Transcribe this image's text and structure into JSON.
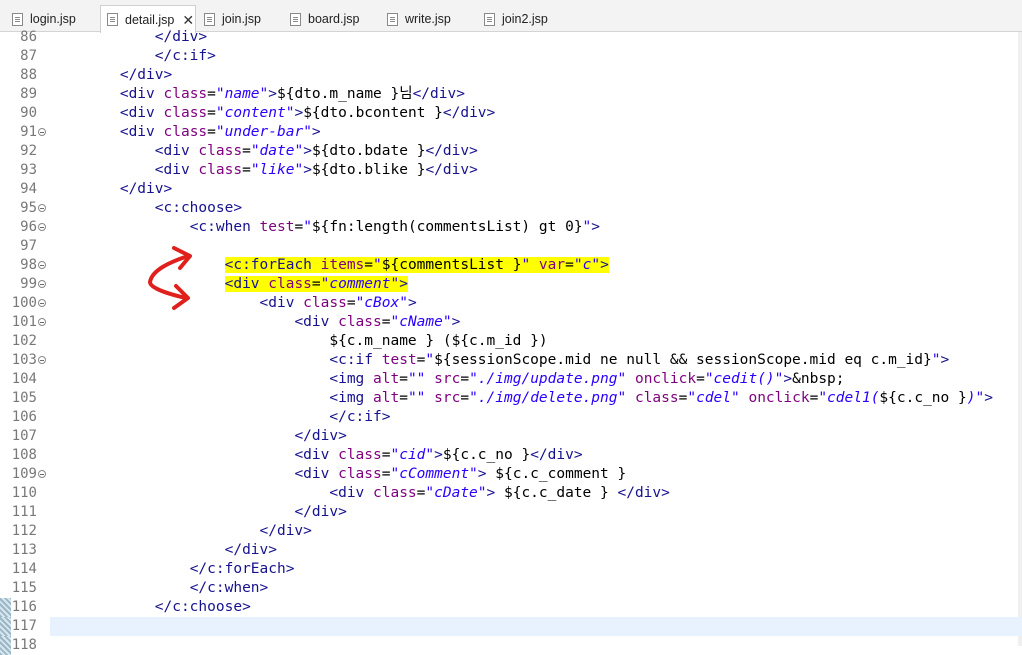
{
  "tabs": [
    {
      "label": "login.jsp",
      "active": false
    },
    {
      "label": "detail.jsp",
      "active": true,
      "close": "✕"
    },
    {
      "label": "join.jsp",
      "active": false
    },
    {
      "label": "board.jsp",
      "active": false
    },
    {
      "label": "write.jsp",
      "active": false
    },
    {
      "label": "join2.jsp",
      "active": false
    }
  ],
  "colors": {
    "tag": "#17128e",
    "attribute": "#7f007f",
    "value": "#2a00ff",
    "highlight": "#ffff00",
    "annotation": "#e0201c"
  },
  "lines": [
    {
      "n": "86",
      "fold": false,
      "segs": [
        [
          "t",
          "            "
        ],
        [
          "tag",
          "</div>"
        ]
      ]
    },
    {
      "n": "87",
      "fold": false,
      "segs": [
        [
          "t",
          "            "
        ],
        [
          "tag",
          "</c:if>"
        ]
      ]
    },
    {
      "n": "88",
      "fold": false,
      "segs": [
        [
          "t",
          "        "
        ],
        [
          "tag",
          "</div>"
        ]
      ]
    },
    {
      "n": "89",
      "fold": false,
      "segs": [
        [
          "t",
          "        "
        ],
        [
          "tag",
          "<div "
        ],
        [
          "attr",
          "class"
        ],
        [
          "t",
          "="
        ],
        [
          "val",
          "\"name\""
        ],
        [
          "tag",
          ">"
        ],
        [
          "t",
          "${dto.m_name }님"
        ],
        [
          "tag",
          "</div>"
        ]
      ]
    },
    {
      "n": "90",
      "fold": false,
      "segs": [
        [
          "t",
          "        "
        ],
        [
          "tag",
          "<div "
        ],
        [
          "attr",
          "class"
        ],
        [
          "t",
          "="
        ],
        [
          "val",
          "\"content\""
        ],
        [
          "tag",
          ">"
        ],
        [
          "t",
          "${dto.bcontent }"
        ],
        [
          "tag",
          "</div>"
        ]
      ]
    },
    {
      "n": "91",
      "fold": true,
      "segs": [
        [
          "t",
          "        "
        ],
        [
          "tag",
          "<div "
        ],
        [
          "attr",
          "class"
        ],
        [
          "t",
          "="
        ],
        [
          "val",
          "\"under-bar\""
        ],
        [
          "tag",
          ">"
        ]
      ]
    },
    {
      "n": "92",
      "fold": false,
      "segs": [
        [
          "t",
          "            "
        ],
        [
          "tag",
          "<div "
        ],
        [
          "attr",
          "class"
        ],
        [
          "t",
          "="
        ],
        [
          "val",
          "\"date\""
        ],
        [
          "tag",
          ">"
        ],
        [
          "t",
          "${dto.bdate }"
        ],
        [
          "tag",
          "</div>"
        ]
      ]
    },
    {
      "n": "93",
      "fold": false,
      "segs": [
        [
          "t",
          "            "
        ],
        [
          "tag",
          "<div "
        ],
        [
          "attr",
          "class"
        ],
        [
          "t",
          "="
        ],
        [
          "val",
          "\"like\""
        ],
        [
          "tag",
          ">"
        ],
        [
          "t",
          "${dto.blike }"
        ],
        [
          "tag",
          "</div>"
        ]
      ]
    },
    {
      "n": "94",
      "fold": false,
      "segs": [
        [
          "t",
          "        "
        ],
        [
          "tag",
          "</div>"
        ]
      ]
    },
    {
      "n": "95",
      "fold": true,
      "segs": [
        [
          "t",
          "            "
        ],
        [
          "tag",
          "<c:choose>"
        ]
      ]
    },
    {
      "n": "96",
      "fold": true,
      "segs": [
        [
          "t",
          "                "
        ],
        [
          "tag",
          "<c:when "
        ],
        [
          "attr",
          "test"
        ],
        [
          "t",
          "="
        ],
        [
          "val",
          "\""
        ],
        [
          "t",
          "${fn:length(commentsList) gt 0}"
        ],
        [
          "val",
          "\""
        ],
        [
          "tag",
          ">"
        ]
      ]
    },
    {
      "n": "97",
      "fold": false,
      "segs": []
    },
    {
      "n": "98",
      "fold": true,
      "segs": [
        [
          "t",
          "                    "
        ],
        [
          "hltag",
          "<c:forEach "
        ],
        [
          "hlattr",
          "items"
        ],
        [
          "hlt",
          "="
        ],
        [
          "hlval",
          "\""
        ],
        [
          "hlt",
          "${commentsList }"
        ],
        [
          "hlval",
          "\" "
        ],
        [
          "hlattr",
          "var"
        ],
        [
          "hlt",
          "="
        ],
        [
          "hlval",
          "\"c\""
        ],
        [
          "hltag",
          ">"
        ]
      ]
    },
    {
      "n": "99",
      "fold": true,
      "segs": [
        [
          "t",
          "                    "
        ],
        [
          "hltag",
          "<div "
        ],
        [
          "hlattr",
          "class"
        ],
        [
          "hlt",
          "="
        ],
        [
          "hlval",
          "\"comment\""
        ],
        [
          "hltag",
          ">"
        ]
      ]
    },
    {
      "n": "100",
      "fold": true,
      "segs": [
        [
          "t",
          "                        "
        ],
        [
          "tag",
          "<div "
        ],
        [
          "attr",
          "class"
        ],
        [
          "t",
          "="
        ],
        [
          "val",
          "\"cBox\""
        ],
        [
          "tag",
          ">"
        ]
      ]
    },
    {
      "n": "101",
      "fold": true,
      "segs": [
        [
          "t",
          "                            "
        ],
        [
          "tag",
          "<div "
        ],
        [
          "attr",
          "class"
        ],
        [
          "t",
          "="
        ],
        [
          "val",
          "\"cName\""
        ],
        [
          "tag",
          ">"
        ]
      ]
    },
    {
      "n": "102",
      "fold": false,
      "segs": [
        [
          "t",
          "                                ${c.m_name } (${c.m_id })"
        ]
      ]
    },
    {
      "n": "103",
      "fold": true,
      "segs": [
        [
          "t",
          "                                "
        ],
        [
          "tag",
          "<c:if "
        ],
        [
          "attr",
          "test"
        ],
        [
          "t",
          "="
        ],
        [
          "val",
          "\""
        ],
        [
          "t",
          "${sessionScope.mid ne null && sessionScope.mid eq c.m_id}"
        ],
        [
          "val",
          "\""
        ],
        [
          "tag",
          ">"
        ]
      ]
    },
    {
      "n": "104",
      "fold": false,
      "segs": [
        [
          "t",
          "                                "
        ],
        [
          "tag",
          "<img "
        ],
        [
          "attr",
          "alt"
        ],
        [
          "t",
          "="
        ],
        [
          "val",
          "\"\" "
        ],
        [
          "attr",
          "src"
        ],
        [
          "t",
          "="
        ],
        [
          "val",
          "\"./img/update.png\" "
        ],
        [
          "attr",
          "onclick"
        ],
        [
          "t",
          "="
        ],
        [
          "val",
          "\"cedit()\""
        ],
        [
          "tag",
          ">"
        ],
        [
          "t",
          "&nbsp;"
        ]
      ]
    },
    {
      "n": "105",
      "fold": false,
      "segs": [
        [
          "t",
          "                                "
        ],
        [
          "tag",
          "<img "
        ],
        [
          "attr",
          "alt"
        ],
        [
          "t",
          "="
        ],
        [
          "val",
          "\"\" "
        ],
        [
          "attr",
          "src"
        ],
        [
          "t",
          "="
        ],
        [
          "val",
          "\"./img/delete.png\" "
        ],
        [
          "attr",
          "class"
        ],
        [
          "t",
          "="
        ],
        [
          "val",
          "\"cdel\" "
        ],
        [
          "attr",
          "onclick"
        ],
        [
          "t",
          "="
        ],
        [
          "val",
          "\"cdel1("
        ],
        [
          "t",
          "${c.c_no }"
        ],
        [
          "val",
          ")\""
        ],
        [
          "tag",
          ">"
        ]
      ]
    },
    {
      "n": "106",
      "fold": false,
      "segs": [
        [
          "t",
          "                                "
        ],
        [
          "tag",
          "</c:if>"
        ]
      ]
    },
    {
      "n": "107",
      "fold": false,
      "segs": [
        [
          "t",
          "                            "
        ],
        [
          "tag",
          "</div>"
        ]
      ]
    },
    {
      "n": "108",
      "fold": false,
      "segs": [
        [
          "t",
          "                            "
        ],
        [
          "tag",
          "<div "
        ],
        [
          "attr",
          "class"
        ],
        [
          "t",
          "="
        ],
        [
          "val",
          "\"cid\""
        ],
        [
          "tag",
          ">"
        ],
        [
          "t",
          "${c.c_no }"
        ],
        [
          "tag",
          "</div>"
        ]
      ]
    },
    {
      "n": "109",
      "fold": true,
      "segs": [
        [
          "t",
          "                            "
        ],
        [
          "tag",
          "<div "
        ],
        [
          "attr",
          "class"
        ],
        [
          "t",
          "="
        ],
        [
          "val",
          "\"cComment\""
        ],
        [
          "tag",
          "> "
        ],
        [
          "t",
          "${c.c_comment }"
        ]
      ]
    },
    {
      "n": "110",
      "fold": false,
      "segs": [
        [
          "t",
          "                                "
        ],
        [
          "tag",
          "<div "
        ],
        [
          "attr",
          "class"
        ],
        [
          "t",
          "="
        ],
        [
          "val",
          "\"cDate\""
        ],
        [
          "tag",
          "> "
        ],
        [
          "t",
          "${c.c_date }"
        ],
        [
          "tag",
          " </div>"
        ]
      ]
    },
    {
      "n": "111",
      "fold": false,
      "segs": [
        [
          "t",
          "                            "
        ],
        [
          "tag",
          "</div>"
        ]
      ]
    },
    {
      "n": "112",
      "fold": false,
      "segs": [
        [
          "t",
          "                        "
        ],
        [
          "tag",
          "</div>"
        ]
      ]
    },
    {
      "n": "113",
      "fold": false,
      "segs": [
        [
          "t",
          "                    "
        ],
        [
          "tag",
          "</div>"
        ]
      ]
    },
    {
      "n": "114",
      "fold": false,
      "segs": [
        [
          "t",
          "                "
        ],
        [
          "tag",
          "</c:forEach>"
        ]
      ]
    },
    {
      "n": "115",
      "fold": false,
      "segs": [
        [
          "t",
          "                "
        ],
        [
          "tag",
          "</c:when>"
        ]
      ]
    },
    {
      "n": "116",
      "fold": false,
      "segs": [
        [
          "t",
          "            "
        ],
        [
          "tag",
          "</c:choose>"
        ]
      ]
    },
    {
      "n": "117",
      "fold": false,
      "segs": []
    },
    {
      "n": "118",
      "fold": false,
      "segs": []
    }
  ]
}
